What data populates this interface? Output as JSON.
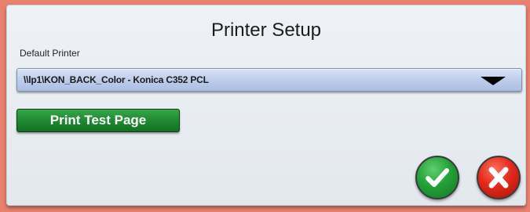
{
  "dialog": {
    "title": "Printer Setup",
    "default_printer_label": "Default Printer",
    "default_printer_value": "\\\\lp1\\KON_BACK_Color - Konica C352 PCL",
    "print_test_page_label": "Print Test Page"
  },
  "icons": {
    "dropdown": "chevron-down-icon",
    "ok": "checkmark-icon",
    "cancel": "x-icon"
  },
  "colors": {
    "background": "#e8816f",
    "dialog": "#e8edf2",
    "dropdown": "#bccbeb",
    "test_button": "#1f8a33",
    "ok_button": "#24a039",
    "cancel_button": "#e2291c"
  }
}
